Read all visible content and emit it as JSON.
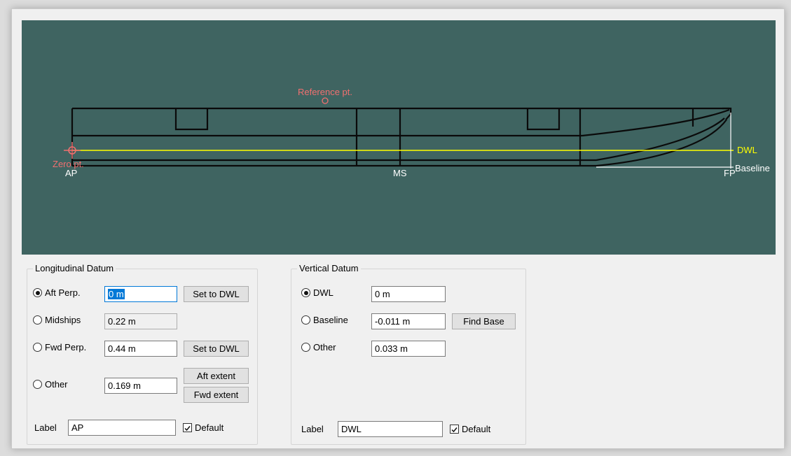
{
  "canvas": {
    "background": "#3f6461",
    "reference_label": "Reference pt.",
    "zero_label": "Zero pt.",
    "ap_label": "AP",
    "ms_label": "MS",
    "fp_label": "FP",
    "dwl_label": "DWL",
    "baseline_label": "Baseline",
    "colors": {
      "hull": "#0a0a0a",
      "dwl": "#ffff00",
      "reference": "#f07070",
      "label": "#ffffff"
    }
  },
  "longitudinal": {
    "title": "Longitudinal Datum",
    "options": [
      {
        "label": "Aft Perp.",
        "value": "0 m",
        "selected": true,
        "button": "Set to DWL"
      },
      {
        "label": "Midships",
        "value": "0.22 m",
        "selected": false
      },
      {
        "label": "Fwd Perp.",
        "value": "0.44 m",
        "selected": false,
        "button": "Set to DWL"
      },
      {
        "label": "Other",
        "value": "0.169 m",
        "selected": false
      }
    ],
    "aft_extent_button": "Aft extent",
    "fwd_extent_button": "Fwd extent",
    "label_caption": "Label",
    "label_value": "AP",
    "default_label": "Default",
    "default_checked": true
  },
  "vertical": {
    "title": "Vertical Datum",
    "options": [
      {
        "label": "DWL",
        "value": "0 m",
        "selected": true
      },
      {
        "label": "Baseline",
        "value": "-0.011 m",
        "selected": false,
        "button": "Find Base"
      },
      {
        "label": "Other",
        "value": "0.033 m",
        "selected": false
      }
    ],
    "label_caption": "Label",
    "label_value": "DWL",
    "default_label": "Default",
    "default_checked": true
  }
}
